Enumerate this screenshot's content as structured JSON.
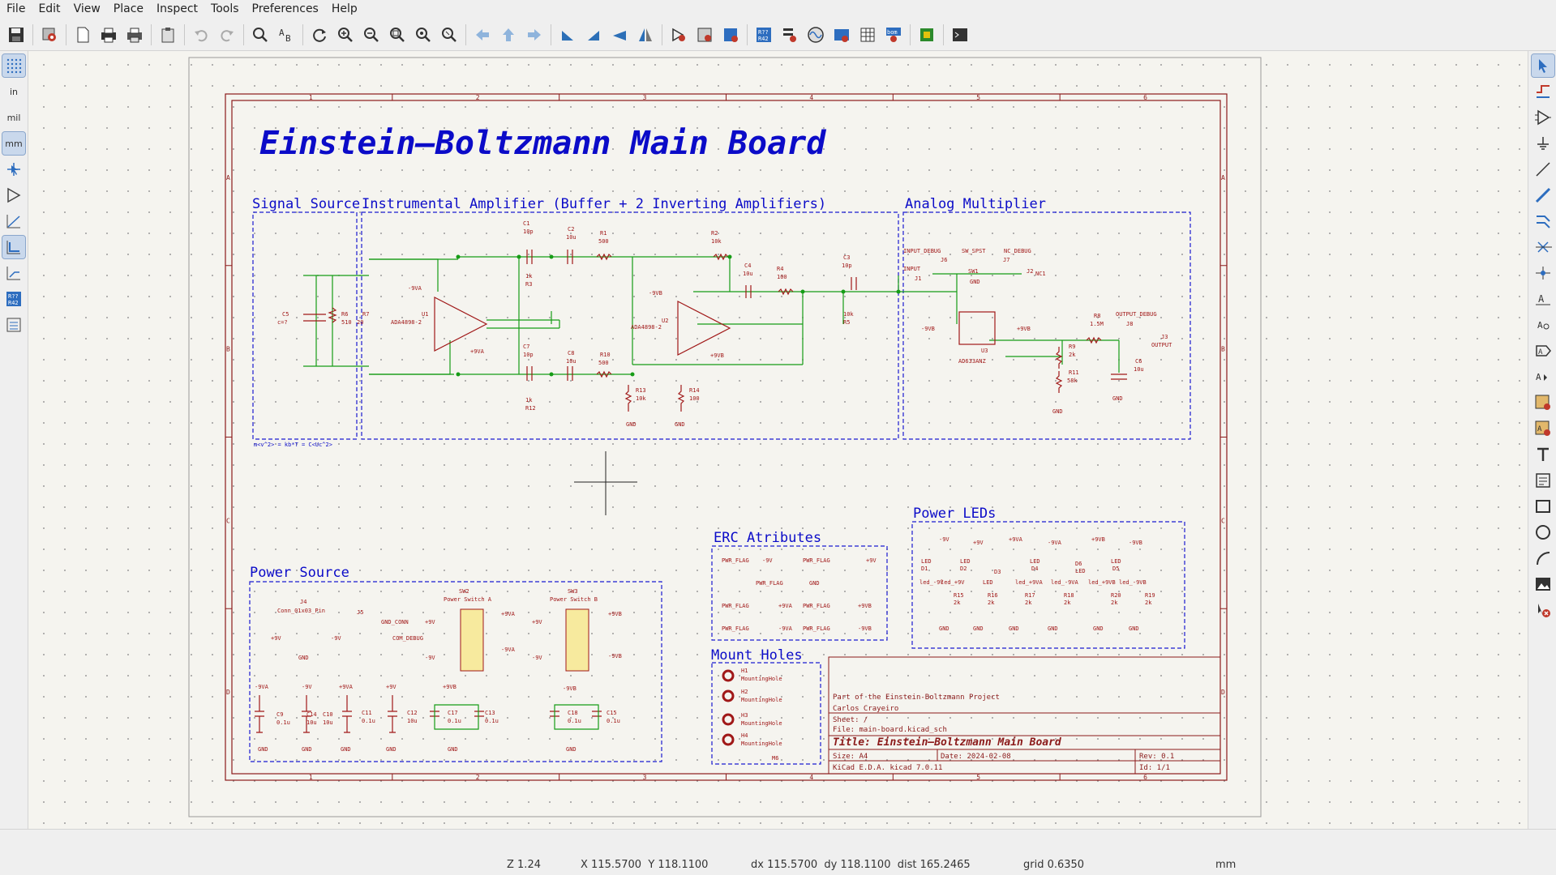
{
  "menu": [
    "File",
    "Edit",
    "View",
    "Place",
    "Inspect",
    "Tools",
    "Preferences",
    "Help"
  ],
  "toolbar_icons": [
    "save-icon",
    "schematic-setup-icon",
    "page-settings-icon",
    "print-icon",
    "plot-icon",
    "paste-icon",
    "undo-icon",
    "redo-icon",
    "find-icon",
    "find-replace-icon",
    "refresh-icon",
    "zoom-in-icon",
    "zoom-out-icon",
    "zoom-fit-icon",
    "zoom-objects-icon",
    "zoom-selection-icon",
    "navigate-back-icon",
    "navigate-up-icon",
    "navigate-forward-icon",
    "rotate-ccw-icon",
    "rotate-cw-icon",
    "mirror-v-icon",
    "mirror-h-icon",
    "symbol-editor-icon",
    "symbol-browser-icon",
    "footprint-assign-icon",
    "annotate-icon",
    "erc-icon",
    "simulator-icon",
    "netlist-icon",
    "bom-icon",
    "bom-generate-icon",
    "pcb-editor-icon",
    "scripting-console-icon"
  ],
  "left_tools": {
    "grid": "grid-icon",
    "units_in": "in",
    "units_mil": "mil",
    "units_mm": "mm",
    "icons": [
      "select-cursor-icon",
      "hierarchy-icon",
      "line-mode-free-icon",
      "line-mode-90-icon",
      "line-mode-45-icon",
      "annotate-toggle-icon",
      "hierarchy-nav-icon"
    ]
  },
  "right_tools": [
    "select-icon",
    "highlight-net-icon",
    "add-symbol-icon",
    "add-power-icon",
    "add-wire-icon",
    "add-bus-icon",
    "add-bus-entry-icon",
    "no-connect-icon",
    "junction-icon",
    "net-label-icon",
    "global-label-icon",
    "hierarchical-label-icon",
    "hier-sheet-icon",
    "import-sheet-pin-icon",
    "add-text-icon",
    "text-box-icon",
    "rectangle-icon",
    "circle-icon",
    "arc-icon",
    "image-icon",
    "delete-icon"
  ],
  "schematic": {
    "title": "Einstein–Boltzmann Main Board",
    "sections": {
      "signal_source": "Signal Source",
      "inst_amp": "Instrumental Amplifier (Buffer + 2 Inverting Amplifiers)",
      "analog_mult": "Analog Multiplier",
      "power_source": "Power Source",
      "erc": "ERC Atributes",
      "mount": "Mount Holes",
      "power_leds": "Power LEDs"
    },
    "note": "m<v^2> = kb*T = C<Uc^2>",
    "col_numbers": [
      "1",
      "2",
      "3",
      "4",
      "5",
      "6"
    ],
    "row_letters": [
      "A",
      "B",
      "C",
      "D"
    ]
  },
  "title_block": {
    "comment1": "Part of the Einstein-Boltzmann Project",
    "comment2": "Carlos Crayeiro",
    "sheet": "Sheet: /",
    "file": "File: main-board.kicad_sch",
    "title": "Title: Einstein–Boltzmann Main Board",
    "size": "Size: A4",
    "date": "Date: 2024-02-08",
    "rev": "Rev: 0.1",
    "tool": "KiCad E.D.A.  kicad 7.0.11",
    "id": "Id: 1/1"
  },
  "mount_holes": [
    {
      "ref": "H1",
      "val": "MountingHole"
    },
    {
      "ref": "H2",
      "val": "MountingHole"
    },
    {
      "ref": "H3",
      "val": "MountingHole"
    },
    {
      "ref": "H4",
      "val": "MountingHole"
    },
    {
      "ref": "",
      "val": "M6"
    }
  ],
  "status": {
    "zoom": "Z 1.24",
    "pos": "X 115.5700  Y 118.1100",
    "delta": "dx 115.5700  dy 118.1100  dist 165.2465",
    "grid": "grid 0.6350",
    "units": "mm"
  },
  "colors": {
    "border": "#8b1a1a",
    "section": "#1a1ad0",
    "wire": "#169c16",
    "component": "#a01818",
    "text_blue": "#0b0bc8",
    "bg": "#f5f4ef"
  }
}
